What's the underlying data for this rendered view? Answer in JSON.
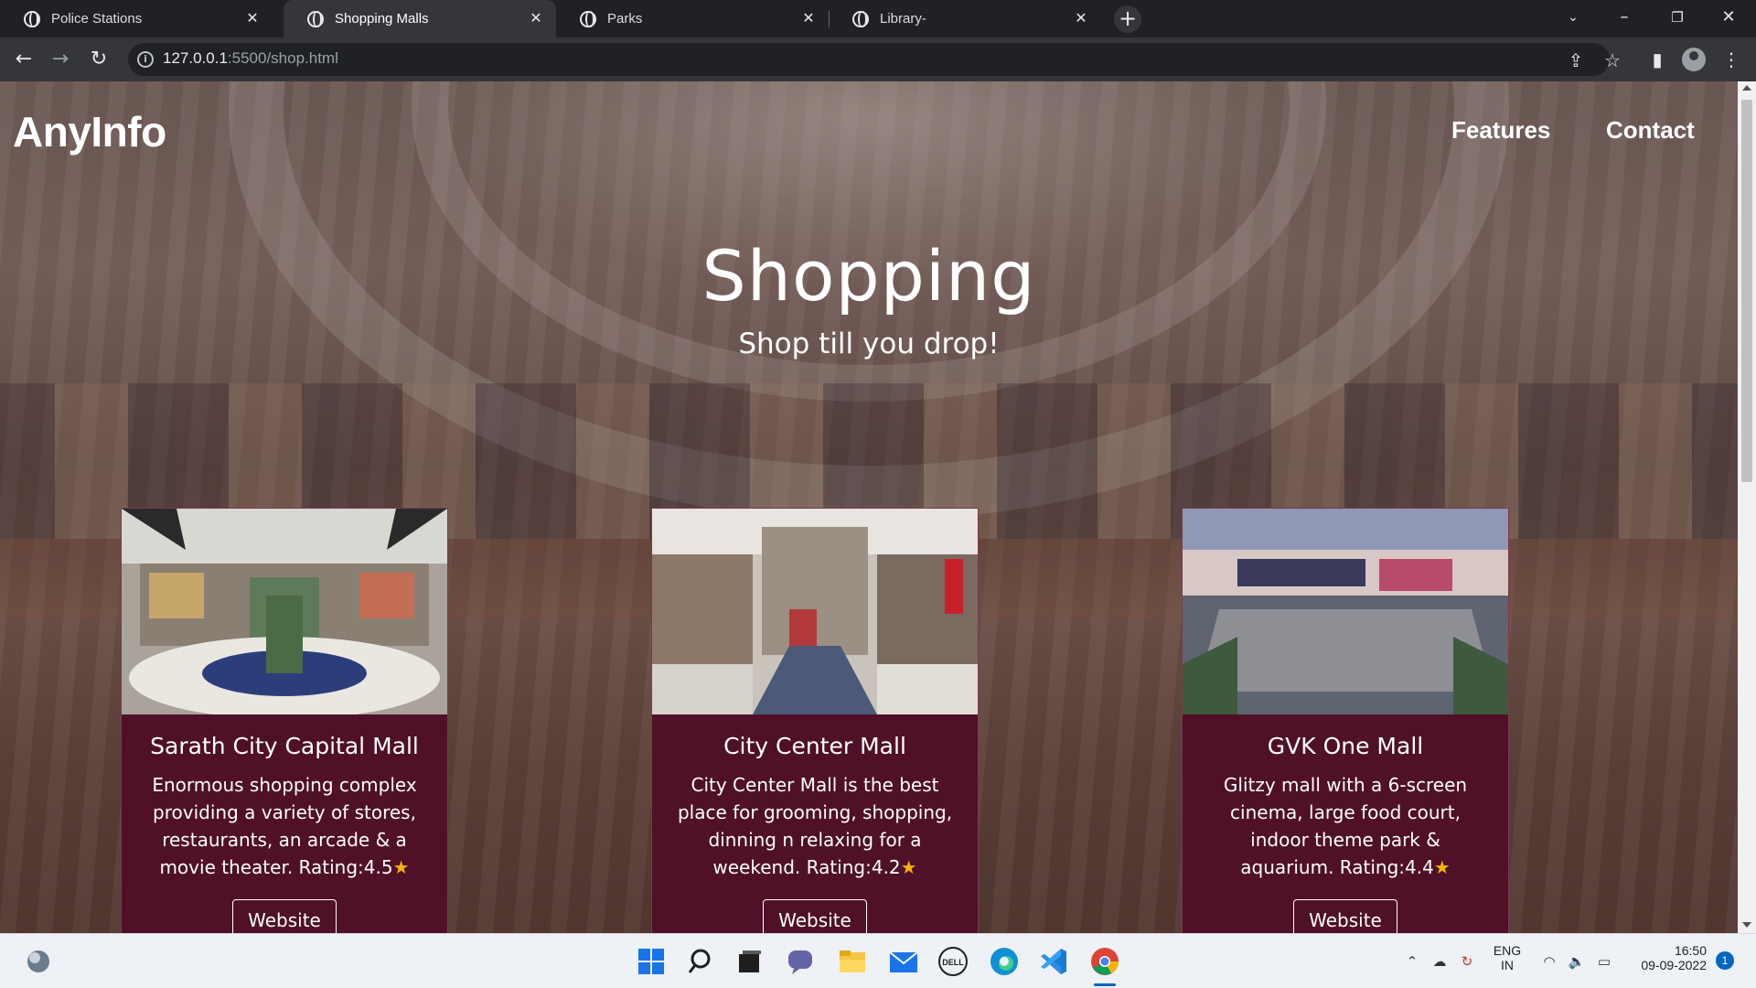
{
  "browser": {
    "tabs": [
      {
        "title": "Police Stations",
        "active": false
      },
      {
        "title": "Shopping Malls",
        "active": true
      },
      {
        "title": "Parks",
        "active": false
      },
      {
        "title": "Library-",
        "active": false
      }
    ],
    "address": {
      "host": "127.0.0.1",
      "path": ":5500/shop.html"
    }
  },
  "site": {
    "logo": "AnyInfo",
    "nav": [
      {
        "label": "Features"
      },
      {
        "label": "Contact"
      }
    ],
    "hero": {
      "title": "Shopping",
      "subtitle": "Shop till you drop!"
    },
    "cards": [
      {
        "name": "Sarath City Capital Mall",
        "description": "Enormous shopping complex providing a variety of stores, restaurants, an arcade & a movie theater. Rating:4.5",
        "rating_icon": "star-icon",
        "button": "Website"
      },
      {
        "name": "City Center Mall",
        "description": "City Center Mall is the best place for grooming, shopping, dinning n relaxing for a weekend. Rating:4.2",
        "rating_icon": "star-icon",
        "button": "Website"
      },
      {
        "name": "GVK One Mall",
        "description": "Glitzy mall with a 6-screen cinema, large food court, indoor theme park & aquarium. Rating:4.4",
        "rating_icon": "star-icon",
        "button": "Website"
      }
    ],
    "card_color": "#4f1028"
  },
  "taskbar": {
    "lang_1": "ENG",
    "lang_2": "IN",
    "time": "16:50",
    "date": "09-09-2022",
    "notification_count": "1"
  }
}
